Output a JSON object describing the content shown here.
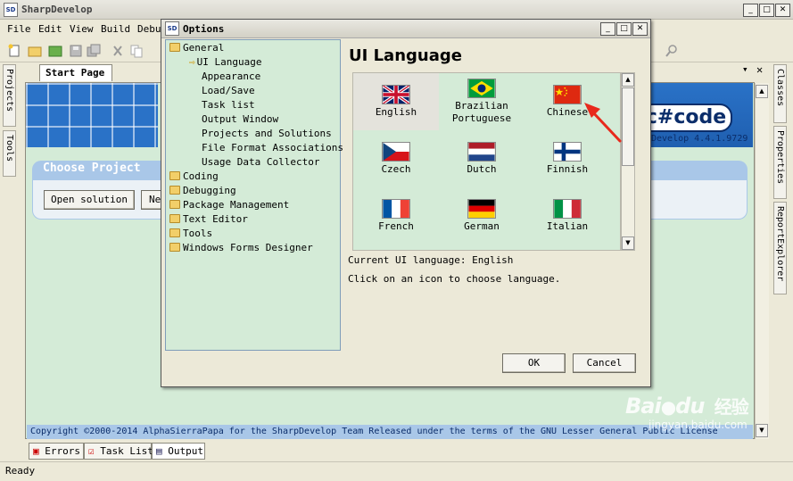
{
  "window": {
    "title": "SharpDevelop",
    "app_icon_text": "SD"
  },
  "menu": [
    "File",
    "Edit",
    "View",
    "Build",
    "Debug"
  ],
  "side_left": {
    "projects": "Projects",
    "tools": "Tools"
  },
  "side_right": {
    "classes": "Classes",
    "properties": "Properties",
    "report_explorer": "ReportExplorer"
  },
  "doc": {
    "tab_label": "Start Page",
    "logo": "c#code",
    "version": "Develop 4.4.1.9729",
    "choose_title": "Choose Project",
    "open_solution": "Open solution",
    "new_button_partial": "Ne",
    "copyright": "Copyright ©2000-2014 AlphaSierraPapa for the SharpDevelop Team    Released under the terms of the GNU Lesser General Public License"
  },
  "bottom_tabs": [
    "Errors",
    "Task List",
    "Output"
  ],
  "status": "Ready",
  "dialog": {
    "title": "Options",
    "heading": "UI Language",
    "tree": {
      "general": "General",
      "general_children": [
        "UI Language",
        "Appearance",
        "Load/Save",
        "Task list",
        "Output Window",
        "Projects and Solutions",
        "File Format Associations",
        "Usage Data Collector"
      ],
      "others": [
        "Coding",
        "Debugging",
        "Package Management",
        "Text Editor",
        "Tools",
        "Windows Forms Designer"
      ]
    },
    "languages": [
      {
        "name": "English",
        "flag": "uk"
      },
      {
        "name": "Brazilian Portuguese",
        "flag": "brazil"
      },
      {
        "name": "Chinese",
        "flag": "china"
      },
      {
        "name": "Czech",
        "flag": "czech"
      },
      {
        "name": "Dutch",
        "flag": "netherlands"
      },
      {
        "name": "Finnish",
        "flag": "finland"
      },
      {
        "name": "French",
        "flag": "france"
      },
      {
        "name": "German",
        "flag": "germany"
      },
      {
        "name": "Italian",
        "flag": "italy"
      }
    ],
    "current_language": "Current UI language: English",
    "hint": "Click on an icon to choose language.",
    "ok": "OK",
    "cancel": "Cancel"
  },
  "watermark": {
    "brand": "Bai",
    "brand2": "du",
    "chinese": "经验",
    "url": "jingyan.baidu.com"
  },
  "colors": {
    "pane_green": "#d4ebd7",
    "banner_blue": "#2a72c7",
    "accent_red": "#e8291c"
  }
}
